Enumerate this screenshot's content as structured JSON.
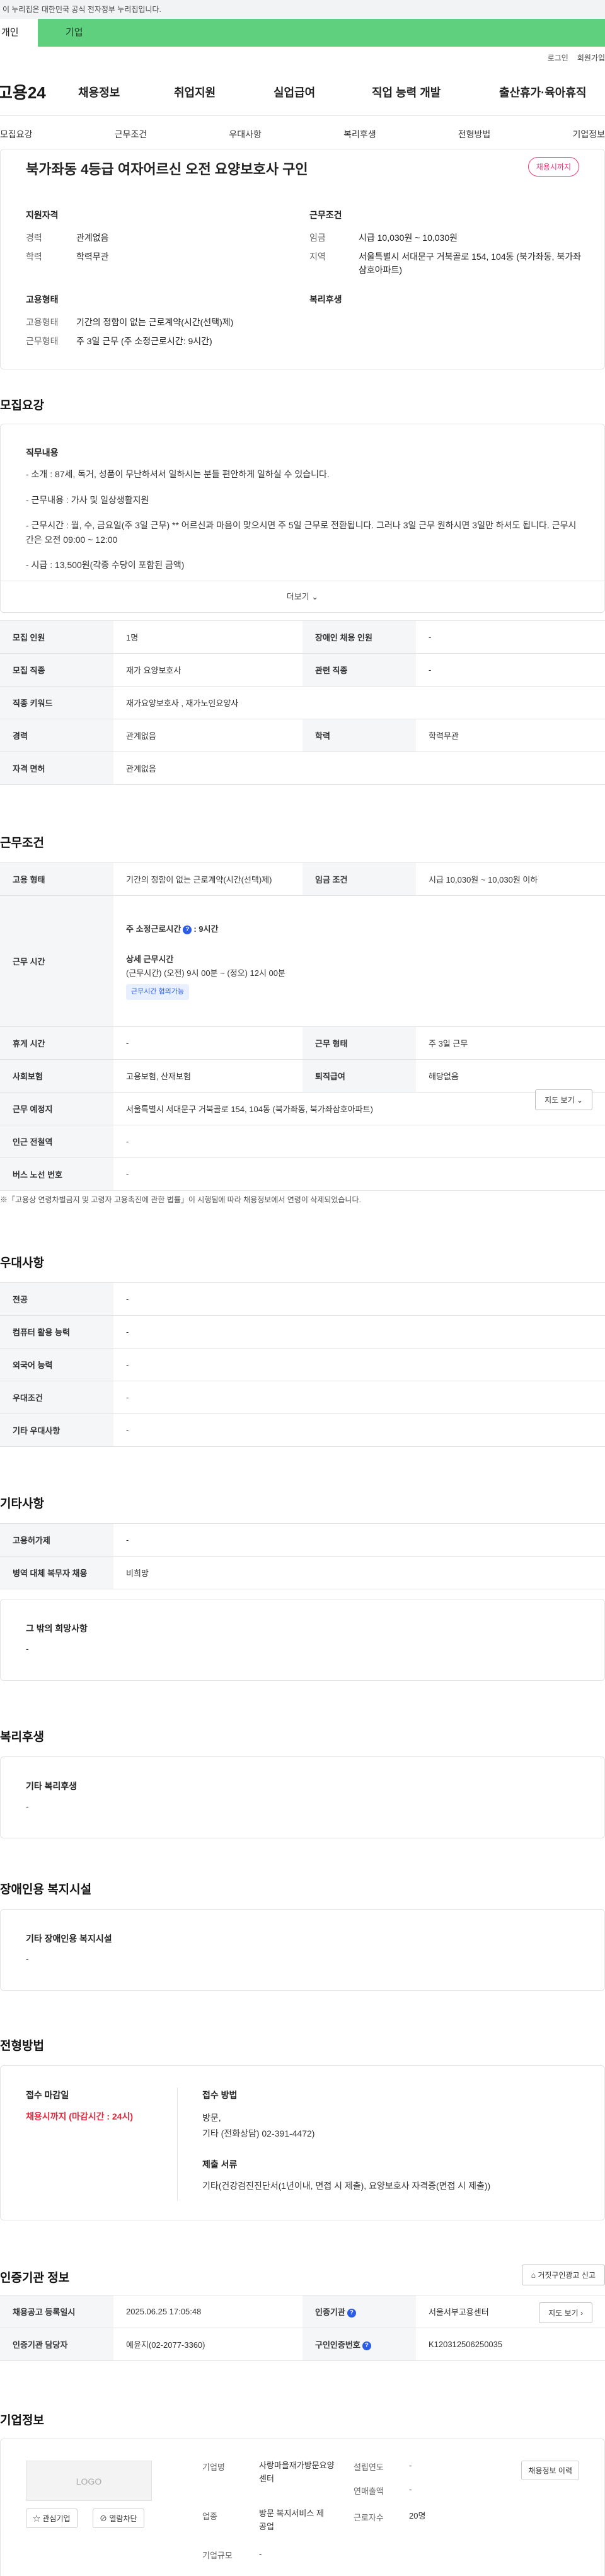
{
  "header": {
    "gov_banner": "이 누리집은 대한민국 공식 전자정부 누리집입니다.",
    "tab_personal": "개인",
    "tab_company": "기업",
    "util_login": "로그인",
    "util_join": "회원가입",
    "logo": "고용24",
    "gnb": [
      "채용정보",
      "취업지원",
      "실업급여",
      "직업 능력 개발",
      "출산휴가·육아휴직"
    ]
  },
  "anchor_nav": [
    "모집요강",
    "근무조건",
    "우대사항",
    "복리후생",
    "전형방법",
    "기업정보"
  ],
  "summary": {
    "title": "북가좌동 4등급 여자어르신 오전 요양보호사 구인",
    "status": "채용시까지",
    "qual_head": "지원자격",
    "qual": [
      {
        "k": "경력",
        "v": "관계없음"
      },
      {
        "k": "학력",
        "v": "학력무관"
      }
    ],
    "cond_head": "근무조건",
    "cond": [
      {
        "k": "임금",
        "v": "시급 10,030원 ~ 10,030원"
      },
      {
        "k": "지역",
        "v": "서울특별시 서대문구 거북골로 154, 104동 (북가좌동, 북가좌삼호아파트)"
      }
    ],
    "emp_head": "고용형태",
    "emp": [
      {
        "k": "고용형태",
        "v": "기간의 정함이 없는 근로계약(시간(선택)제)"
      },
      {
        "k": "근무형태",
        "v": "주 3일 근무 (주 소정근로시간: 9시간)"
      }
    ],
    "welfare_head": "복리후생"
  },
  "recruit": {
    "section_title": "모집요강",
    "desc_head": "직무내용",
    "desc_lines": [
      "- 소개 : 87세, 독거, 성품이 무난하셔서 일하시는 분들 편안하게 일하실 수 있습니다.",
      "- 근무내용 : 가사 및 일상생활지원",
      "- 근무시간 : 월, 수, 금요일(주 3일 근무) ** 어르신과 마음이 맞으시면 주 5일 근무로 전환됩니다. 그러나 3일 근무 원하시면 3일만 하셔도 됩니다. 근무시간은 오전 09:00 ~ 12:00",
      "- 시급 : 13,500원(각종 수당이 포함된 금액)"
    ],
    "more": "더보기",
    "rows": [
      [
        "모집 인원",
        "1명",
        "장애인 채용 인원",
        "-"
      ],
      [
        "모집 직종",
        "재가 요양보호사",
        "관련 직종",
        "-"
      ],
      [
        "직종 키워드",
        "재가요양보호사 , 재가노인요양사"
      ],
      [
        "경력",
        "관계없음",
        "학력",
        "학력무관"
      ],
      [
        "자격 면허",
        "관계없음"
      ]
    ]
  },
  "work": {
    "section_title": "근무조건",
    "emp_type_label": "고용 형태",
    "emp_type": "기간의 정함이 없는 근로계약(시간(선택)제)",
    "wage_label": "임금 조건",
    "wage": "시급 10,030원 ~ 10,030원 이하",
    "hours_label": "근무 시간",
    "weekly_hours": "주 소정근로시간",
    "weekly_hours_help": "?",
    "weekly_hours_value": ": 9시간",
    "detail_head": "상세 근무시간",
    "detail": "(근무시간) (오전) 9시 00분 ~ (정오) 12시 00분",
    "badge": "근무시간 협의가능",
    "rest_label": "휴게 시간",
    "rest": "-",
    "form_label": "근무 형태",
    "form": "주 3일 근무",
    "ins_label": "사회보험",
    "ins": "고용보험, 산재보험",
    "sev_label": "퇴직급여",
    "sev": "해당없음",
    "place_label": "근무 예정지",
    "place": "서울특별시 서대문구 거북골로 154, 104동 (북가좌동, 북가좌삼호아파트)",
    "map_btn": "지도 보기",
    "station_label": "인근 전철역",
    "station": "-",
    "bus_label": "버스 노선 번호",
    "bus": "-",
    "note": "※「고용상 연령차별금지 및 고령자 고용촉진에 관한 법률」이 시행됨에 따라 채용정보에서 연령이 삭제되었습니다."
  },
  "prefer": {
    "section_title": "우대사항",
    "rows": [
      [
        "전공",
        "-"
      ],
      [
        "컴퓨터 활용 능력",
        "-"
      ],
      [
        "외국어 능력",
        "-"
      ],
      [
        "우대조건",
        "-"
      ],
      [
        "기타 우대사항",
        "-"
      ]
    ]
  },
  "etc": {
    "section_title": "기타사항",
    "rows": [
      [
        "고용허가제",
        "-"
      ],
      [
        "병역 대체 복무자 채용",
        "비희망"
      ]
    ],
    "other_label": "그 밖의 희망사항",
    "other_value": "-"
  },
  "welfare": {
    "section_title": "복리후생",
    "label": "기타 복리후생",
    "value": "-"
  },
  "disabled": {
    "section_title": "장애인용 복지시설",
    "label": "기타 장애인용 복지시설",
    "value": "-"
  },
  "process": {
    "section_title": "전형방법",
    "deadline_label": "접수 마감일",
    "deadline": "채용시까지 (마감시간 : 24시)",
    "method_label": "접수 방법",
    "method_line1": "방문,",
    "method_line2": "기타 (전화상담) 02-391-4472)",
    "docs_label": "제출 서류",
    "docs": "기타(건강검진진단서(1년이내, 면접 시 제출), 요양보호사 자격증(면접 시 제출))"
  },
  "cert": {
    "section_title": "인증기관 정보",
    "report_btn": "거짓구인광고 신고",
    "rows": [
      [
        "채용공고 등록일시",
        "2025.06.25 17:05:48",
        "인증기관",
        "서울서부고용센터"
      ],
      [
        "인증기관 담당자",
        "예윤지(02-2077-3360)",
        "구인인증번호",
        "K120312506250035"
      ]
    ],
    "map_btn": "지도 보기"
  },
  "company": {
    "section_title": "기업정보",
    "logo_text": "LOGO",
    "interest_btn": "관심기업",
    "block_btn": "열람차단",
    "history_btn": "채용정보 이력",
    "name_label": "기업명",
    "name": "사랑마을재가방문요양센터",
    "industry_label": "업종",
    "industry": "방문 복지서비스 제공업",
    "size_label": "기업규모",
    "size": "-",
    "founded_label": "설립연도",
    "founded": "-",
    "sales_label": "연매출액",
    "sales": "-",
    "staff_label": "근로자수",
    "staff": "20명"
  },
  "colors": {
    "accent": "#5fd07e",
    "status": "#e8377a",
    "deadline": "#e1263b",
    "link": "#2b5ce6"
  }
}
